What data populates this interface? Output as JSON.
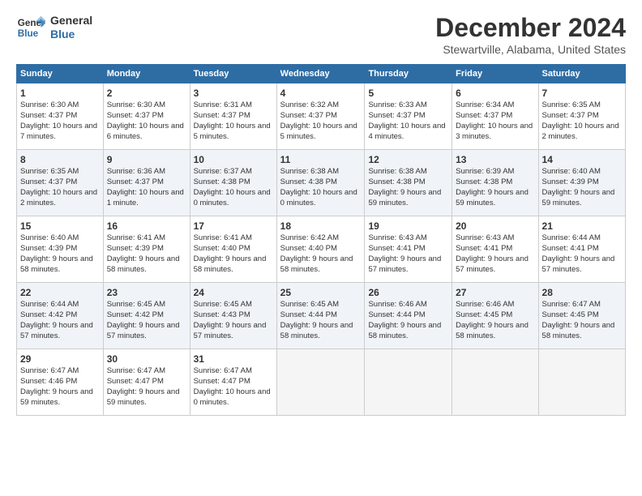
{
  "logo": {
    "line1": "General",
    "line2": "Blue"
  },
  "title": "December 2024",
  "subtitle": "Stewartville, Alabama, United States",
  "days_of_week": [
    "Sunday",
    "Monday",
    "Tuesday",
    "Wednesday",
    "Thursday",
    "Friday",
    "Saturday"
  ],
  "weeks": [
    [
      {
        "day": 1,
        "lines": [
          "Sunrise: 6:30 AM",
          "Sunset: 4:37 PM",
          "Daylight: 10 hours",
          "and 7 minutes."
        ]
      },
      {
        "day": 2,
        "lines": [
          "Sunrise: 6:30 AM",
          "Sunset: 4:37 PM",
          "Daylight: 10 hours",
          "and 6 minutes."
        ]
      },
      {
        "day": 3,
        "lines": [
          "Sunrise: 6:31 AM",
          "Sunset: 4:37 PM",
          "Daylight: 10 hours",
          "and 5 minutes."
        ]
      },
      {
        "day": 4,
        "lines": [
          "Sunrise: 6:32 AM",
          "Sunset: 4:37 PM",
          "Daylight: 10 hours",
          "and 5 minutes."
        ]
      },
      {
        "day": 5,
        "lines": [
          "Sunrise: 6:33 AM",
          "Sunset: 4:37 PM",
          "Daylight: 10 hours",
          "and 4 minutes."
        ]
      },
      {
        "day": 6,
        "lines": [
          "Sunrise: 6:34 AM",
          "Sunset: 4:37 PM",
          "Daylight: 10 hours",
          "and 3 minutes."
        ]
      },
      {
        "day": 7,
        "lines": [
          "Sunrise: 6:35 AM",
          "Sunset: 4:37 PM",
          "Daylight: 10 hours",
          "and 2 minutes."
        ]
      }
    ],
    [
      {
        "day": 8,
        "lines": [
          "Sunrise: 6:35 AM",
          "Sunset: 4:37 PM",
          "Daylight: 10 hours",
          "and 2 minutes."
        ]
      },
      {
        "day": 9,
        "lines": [
          "Sunrise: 6:36 AM",
          "Sunset: 4:37 PM",
          "Daylight: 10 hours",
          "and 1 minute."
        ]
      },
      {
        "day": 10,
        "lines": [
          "Sunrise: 6:37 AM",
          "Sunset: 4:38 PM",
          "Daylight: 10 hours",
          "and 0 minutes."
        ]
      },
      {
        "day": 11,
        "lines": [
          "Sunrise: 6:38 AM",
          "Sunset: 4:38 PM",
          "Daylight: 10 hours",
          "and 0 minutes."
        ]
      },
      {
        "day": 12,
        "lines": [
          "Sunrise: 6:38 AM",
          "Sunset: 4:38 PM",
          "Daylight: 9 hours",
          "and 59 minutes."
        ]
      },
      {
        "day": 13,
        "lines": [
          "Sunrise: 6:39 AM",
          "Sunset: 4:38 PM",
          "Daylight: 9 hours",
          "and 59 minutes."
        ]
      },
      {
        "day": 14,
        "lines": [
          "Sunrise: 6:40 AM",
          "Sunset: 4:39 PM",
          "Daylight: 9 hours",
          "and 59 minutes."
        ]
      }
    ],
    [
      {
        "day": 15,
        "lines": [
          "Sunrise: 6:40 AM",
          "Sunset: 4:39 PM",
          "Daylight: 9 hours",
          "and 58 minutes."
        ]
      },
      {
        "day": 16,
        "lines": [
          "Sunrise: 6:41 AM",
          "Sunset: 4:39 PM",
          "Daylight: 9 hours",
          "and 58 minutes."
        ]
      },
      {
        "day": 17,
        "lines": [
          "Sunrise: 6:41 AM",
          "Sunset: 4:40 PM",
          "Daylight: 9 hours",
          "and 58 minutes."
        ]
      },
      {
        "day": 18,
        "lines": [
          "Sunrise: 6:42 AM",
          "Sunset: 4:40 PM",
          "Daylight: 9 hours",
          "and 58 minutes."
        ]
      },
      {
        "day": 19,
        "lines": [
          "Sunrise: 6:43 AM",
          "Sunset: 4:41 PM",
          "Daylight: 9 hours",
          "and 57 minutes."
        ]
      },
      {
        "day": 20,
        "lines": [
          "Sunrise: 6:43 AM",
          "Sunset: 4:41 PM",
          "Daylight: 9 hours",
          "and 57 minutes."
        ]
      },
      {
        "day": 21,
        "lines": [
          "Sunrise: 6:44 AM",
          "Sunset: 4:41 PM",
          "Daylight: 9 hours",
          "and 57 minutes."
        ]
      }
    ],
    [
      {
        "day": 22,
        "lines": [
          "Sunrise: 6:44 AM",
          "Sunset: 4:42 PM",
          "Daylight: 9 hours",
          "and 57 minutes."
        ]
      },
      {
        "day": 23,
        "lines": [
          "Sunrise: 6:45 AM",
          "Sunset: 4:42 PM",
          "Daylight: 9 hours",
          "and 57 minutes."
        ]
      },
      {
        "day": 24,
        "lines": [
          "Sunrise: 6:45 AM",
          "Sunset: 4:43 PM",
          "Daylight: 9 hours",
          "and 57 minutes."
        ]
      },
      {
        "day": 25,
        "lines": [
          "Sunrise: 6:45 AM",
          "Sunset: 4:44 PM",
          "Daylight: 9 hours",
          "and 58 minutes."
        ]
      },
      {
        "day": 26,
        "lines": [
          "Sunrise: 6:46 AM",
          "Sunset: 4:44 PM",
          "Daylight: 9 hours",
          "and 58 minutes."
        ]
      },
      {
        "day": 27,
        "lines": [
          "Sunrise: 6:46 AM",
          "Sunset: 4:45 PM",
          "Daylight: 9 hours",
          "and 58 minutes."
        ]
      },
      {
        "day": 28,
        "lines": [
          "Sunrise: 6:47 AM",
          "Sunset: 4:45 PM",
          "Daylight: 9 hours",
          "and 58 minutes."
        ]
      }
    ],
    [
      {
        "day": 29,
        "lines": [
          "Sunrise: 6:47 AM",
          "Sunset: 4:46 PM",
          "Daylight: 9 hours",
          "and 59 minutes."
        ]
      },
      {
        "day": 30,
        "lines": [
          "Sunrise: 6:47 AM",
          "Sunset: 4:47 PM",
          "Daylight: 9 hours",
          "and 59 minutes."
        ]
      },
      {
        "day": 31,
        "lines": [
          "Sunrise: 6:47 AM",
          "Sunset: 4:47 PM",
          "Daylight: 10 hours",
          "and 0 minutes."
        ]
      },
      null,
      null,
      null,
      null
    ]
  ]
}
